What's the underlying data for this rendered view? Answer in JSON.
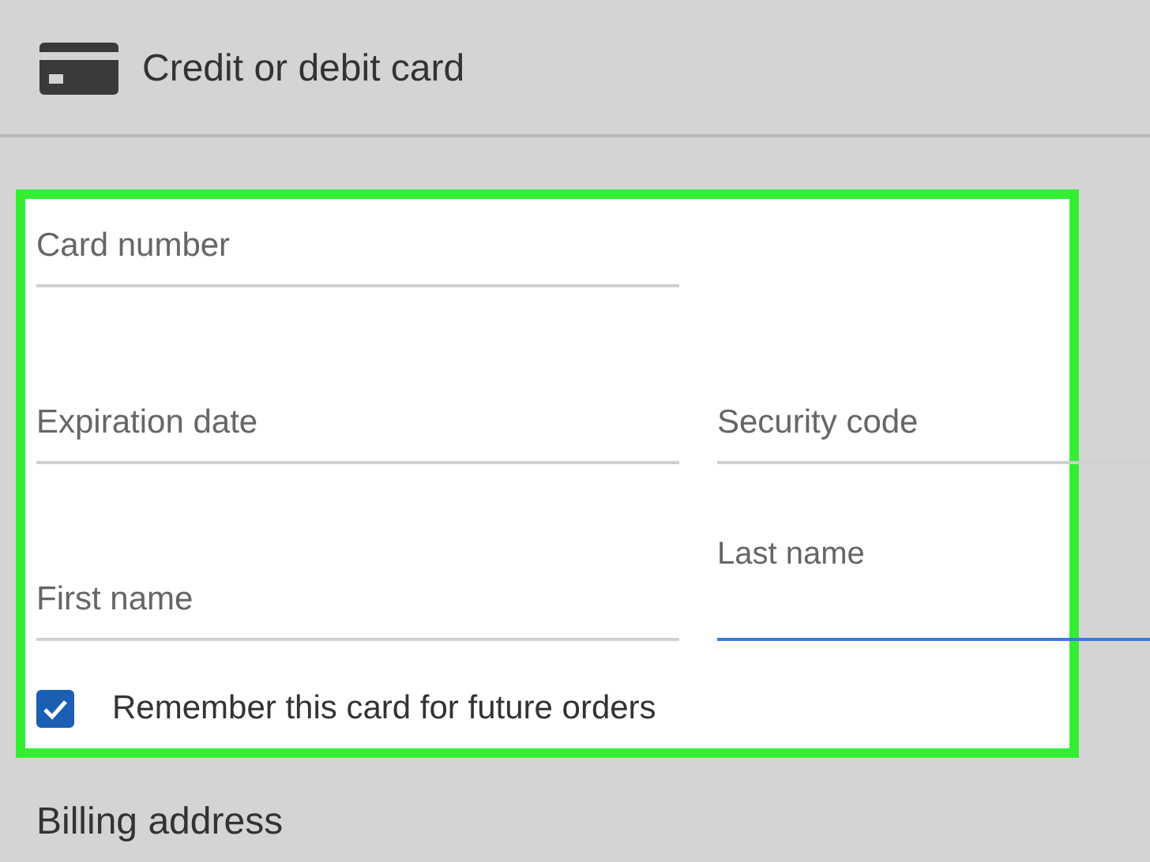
{
  "header": {
    "title": "Credit or debit card"
  },
  "form_rows": [
    [
      {
        "label": "Card number",
        "focused": false
      }
    ],
    [
      {
        "label": "Expiration date",
        "focused": false
      },
      {
        "label": "Security code",
        "focused": false
      }
    ],
    [
      {
        "label": "First name",
        "focused": false
      },
      {
        "label": "Last name",
        "focused": true
      }
    ]
  ],
  "remember": {
    "label": "Remember this card for future orders",
    "checked": true
  },
  "next_section": {
    "title": "Billing address"
  }
}
